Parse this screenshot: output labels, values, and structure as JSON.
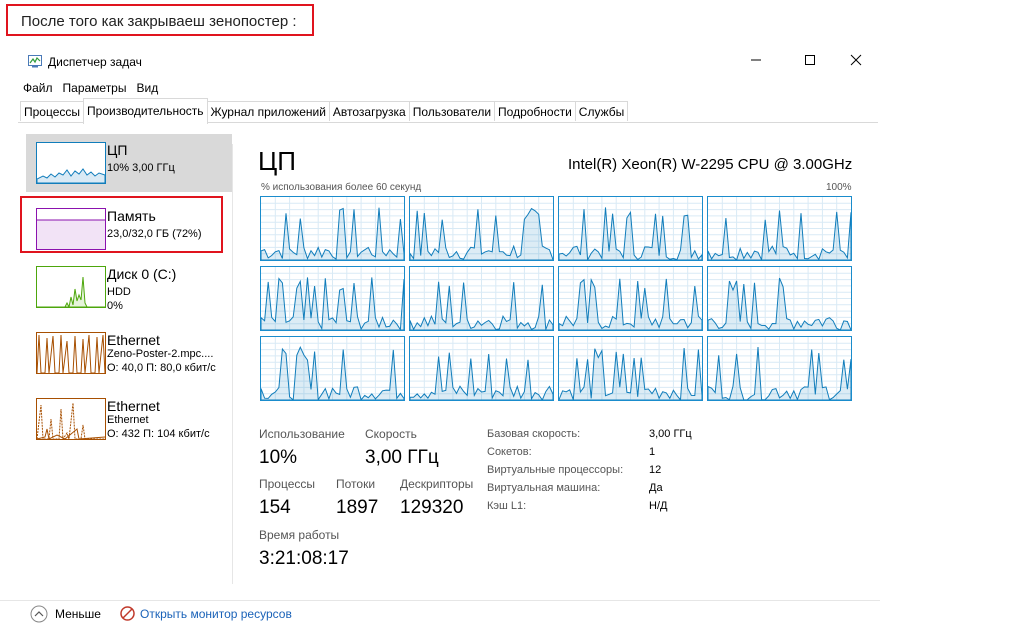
{
  "annotation": {
    "text": "После того как закрываеш зенопостер :"
  },
  "window": {
    "title": "Диспетчер задач",
    "menu": [
      "Файл",
      "Параметры",
      "Вид"
    ],
    "tabs": [
      "Процессы",
      "Производительность",
      "Журнал приложений",
      "Автозагрузка",
      "Пользователи",
      "Подробности",
      "Службы"
    ],
    "active_tab": "Производительность"
  },
  "sidebar": {
    "items": [
      {
        "title": "ЦП",
        "line1": "10% 3,00 ГГц",
        "line2": "",
        "color": "#117dbb",
        "selected": true
      },
      {
        "title": "Память",
        "line1": "23,0/32,0 ГБ (72%)",
        "line2": "",
        "color": "#8b12ae",
        "selected": false
      },
      {
        "title": "Диск 0 (C:)",
        "line1": "HDD",
        "line2": "0%",
        "color": "#4da60c",
        "selected": false
      },
      {
        "title": "Ethernet",
        "line1": "Zeno-Poster-2.mpc....",
        "line2": "О: 40,0 П: 80,0 кбит/с",
        "color": "#a74f01",
        "selected": false
      },
      {
        "title": "Ethernet",
        "line1": "Ethernet",
        "line2": "О: 432 П: 104 кбит/с",
        "color": "#a74f01",
        "selected": false
      }
    ]
  },
  "cpu": {
    "heading": "ЦП",
    "model": "Intel(R) Xeon(R) W-2295 CPU @ 3.00GHz",
    "graph_caption": "% использования более 60 секунд",
    "graph_max": "100%",
    "stats": {
      "usage_label": "Использование",
      "usage_value": "10%",
      "speed_label": "Скорость",
      "speed_value": "3,00 ГГц",
      "processes_label": "Процессы",
      "processes_value": "154",
      "threads_label": "Потоки",
      "threads_value": "1897",
      "handles_label": "Дескрипторы",
      "handles_value": "129320",
      "uptime_label": "Время работы",
      "uptime_value": "3:21:08:17"
    },
    "specs": [
      {
        "key": "Базовая скорость:",
        "value": "3,00 ГГц"
      },
      {
        "key": "Сокетов:",
        "value": "1"
      },
      {
        "key": "Виртуальные процессоры:",
        "value": "12"
      },
      {
        "key": "Виртуальная машина:",
        "value": "Да"
      },
      {
        "key": "Кэш L1:",
        "value": "Н/Д"
      }
    ]
  },
  "footer": {
    "less": "Меньше",
    "monitor": "Открыть монитор ресурсов"
  },
  "colors": {
    "cpu": "#117dbb",
    "memory": "#8b12ae",
    "disk": "#4da60c",
    "ethernet": "#a74f01",
    "annotation": "#e0141e"
  }
}
